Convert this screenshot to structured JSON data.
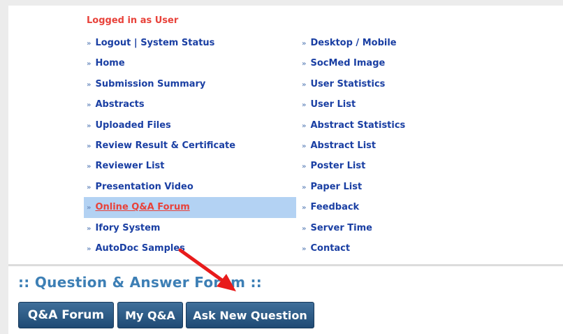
{
  "menu": {
    "logged_in_text": "Logged in as User",
    "bullet": "»",
    "left_items": [
      {
        "label": "Logout | System Status"
      },
      {
        "label": "Home"
      },
      {
        "label": "Submission Summary"
      },
      {
        "label": "Abstracts"
      },
      {
        "label": "Uploaded Files"
      },
      {
        "label": "Review Result & Certificate"
      },
      {
        "label": "Reviewer List"
      },
      {
        "label": "Presentation Video"
      },
      {
        "label": "Online Q&A Forum",
        "active": true
      },
      {
        "label": "Ifory System"
      },
      {
        "label": "AutoDoc Samples"
      }
    ],
    "right_items": [
      {
        "label": "Desktop / Mobile"
      },
      {
        "label": "SocMed Image"
      },
      {
        "label": "User Statistics"
      },
      {
        "label": "User List"
      },
      {
        "label": "Abstract Statistics"
      },
      {
        "label": "Abstract List"
      },
      {
        "label": "Poster List"
      },
      {
        "label": "Paper List"
      },
      {
        "label": "Feedback"
      },
      {
        "label": "Server Time"
      },
      {
        "label": "Contact"
      }
    ]
  },
  "forum": {
    "title": ":: Question & Answer Forum ::",
    "buttons": {
      "forum": "Q&A Forum",
      "my_qa": "My Q&A",
      "ask": "Ask New Question"
    }
  },
  "colors": {
    "link": "#1a3fa3",
    "active_link": "#e8423a",
    "active_bg": "#b3d2f3",
    "title": "#3d7fb5",
    "button": "#1f4a74",
    "annotation_arrow": "#e81b1b"
  },
  "annotation": {
    "icon": "red-arrow-icon"
  }
}
